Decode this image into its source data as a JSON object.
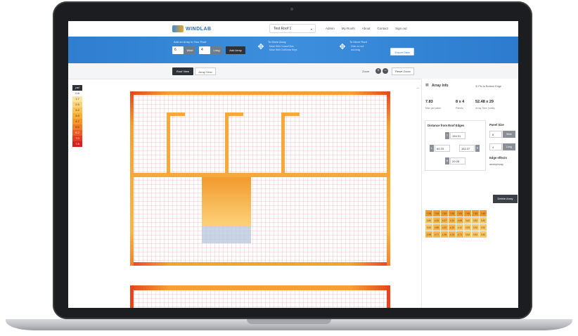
{
  "nav": {
    "logo_text": "WINDLAB",
    "roof_select": "Test Roof 1",
    "links": [
      "Admin",
      "My Roofs",
      "About",
      "Contact",
      "Sign out"
    ]
  },
  "toolbar": {
    "add_label": "Add an Array to Your Roof",
    "cols_value": "6",
    "wide_label": "Wide",
    "rows_value": "4",
    "long_label": "Long",
    "add_button": "Add Array",
    "move_title": "To Move Array",
    "move_line1": "Move With Cursor/Click",
    "move_line2": "Move With Ctrl/Arrow Keys",
    "move2_title": "To Move Roof",
    "move2_line1": "Click on roof",
    "move2_line2": "and drag",
    "export_button": "Export Data"
  },
  "view": {
    "tab_roof": "Roof View",
    "tab_array": "Array View",
    "zoom_label": "Zoom",
    "reset_zoom": "Reset Zoom"
  },
  "legend": {
    "header": "psf",
    "values": [
      "0.8",
      "1.7",
      "2.5",
      "3.2",
      "3.9",
      "4.7",
      "5.5",
      "6.2",
      "7.0",
      "7.8"
    ],
    "colors": [
      "#ffffff",
      "#fde3a0",
      "#fdd27a",
      "#fbc24f",
      "#f9ad35",
      "#f69528",
      "#f27c24",
      "#ed5b22",
      "#e63a20",
      "#d81f1f"
    ]
  },
  "side": {
    "title": "Array Info",
    "pin_label": "Pin to Bottom Edge",
    "stats": [
      {
        "value": "7.83",
        "label": "Max psf value"
      },
      {
        "value": "8 x 4",
        "label": "Panels"
      },
      {
        "value": "52.48 x 29",
        "label": "Array Size (units)"
      }
    ],
    "distance_title": "Distance from Roof Edges",
    "dist_top": "154.01",
    "dist_left": "84.15",
    "dist_right": "162.37",
    "dist_bottom": "20.08",
    "panel_title": "Panel Size",
    "panel_w": "8",
    "panel_w_label": "Wide",
    "panel_l": "4",
    "panel_l_label": "Long",
    "edge_title": "Edge effects",
    "edge_value": "ansiepraray",
    "delete_button": "Delete Array",
    "table": [
      [
        "7.83",
        "7.83",
        "7.83",
        "7.83",
        "7.83",
        "7.83",
        "7.83",
        "7.83"
      ],
      [
        "3.80",
        "4.33",
        "4.37",
        "4.32",
        "4.69",
        "3.62",
        "3.82",
        "3.82"
      ],
      [
        "3.52",
        "4.85",
        "4.32",
        "4.32",
        "4.10",
        "3.53",
        "3.52",
        "3.52"
      ],
      [
        "4.95",
        "4.77",
        "4.35",
        "4.33",
        "4.71",
        "3.53",
        "3.52",
        "3.52"
      ]
    ]
  }
}
